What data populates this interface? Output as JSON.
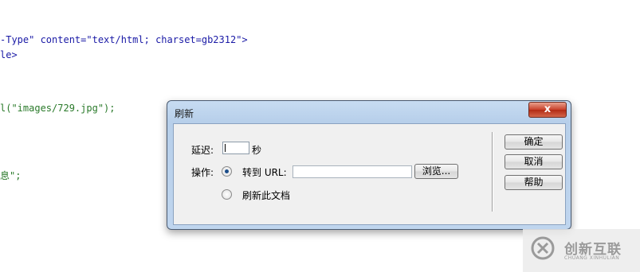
{
  "editor": {
    "lines": [
      "-Type\" content=\"text/html; charset=gb2312\">",
      "le>",
      "l(\"images/729.jpg\");",
      "息\";"
    ]
  },
  "dialog": {
    "title": "刷新",
    "close_label": "x",
    "delay_label": "延迟:",
    "delay_value": "",
    "seconds_label": "秒",
    "action_label": "操作:",
    "goto_url_label": "转到 URL:",
    "url_value": "",
    "browse_label": "浏览...",
    "refresh_doc_label": "刷新此文档",
    "selected_action": "goto_url",
    "ok_label": "确定",
    "cancel_label": "取消",
    "help_label": "帮助"
  },
  "watermark": {
    "brand": "创新互联",
    "subtitle": "CHUANG XINHULIAN",
    "icon": "x-circle-logo-icon"
  }
}
